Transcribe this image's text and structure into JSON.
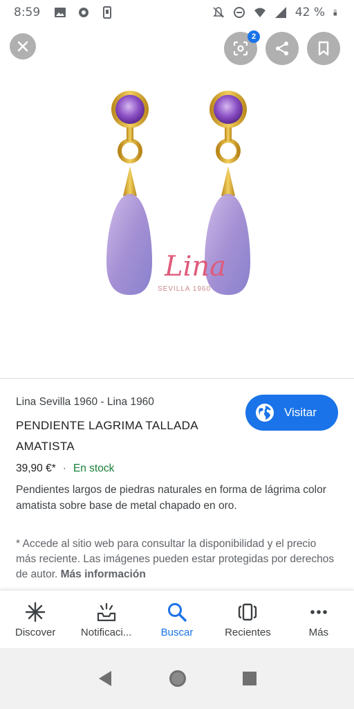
{
  "status_bar": {
    "time": "8:59",
    "battery_percent": "42 %"
  },
  "viewer": {
    "lens_badge_count": "2",
    "watermark_brand": "Lina",
    "watermark_sub": "SEVILLA 1960"
  },
  "product": {
    "source": "Lina Sevilla 1960 - Lina 1960",
    "title": "PENDIENTE LAGRIMA TALLADA AMATISTA",
    "visit_label": "Visitar",
    "price": "39,90 €*",
    "separator": "·",
    "stock": "En stock",
    "description": "Pendientes largos de piedras naturales en forma de lágrima color amatista sobre base de metal chapado en oro.",
    "disclaimer": "* Accede al sitio web para consultar la disponibilidad y el precio más reciente. Las imágenes pueden estar protegidas por derechos de autor.",
    "more_info": "Más información"
  },
  "bottom_nav": {
    "items": [
      {
        "label": "Discover",
        "icon": "discover-icon"
      },
      {
        "label": "Notificaci...",
        "icon": "notifications-icon"
      },
      {
        "label": "Buscar",
        "icon": "search-icon"
      },
      {
        "label": "Recientes",
        "icon": "recents-icon"
      },
      {
        "label": "Más",
        "icon": "more-icon"
      }
    ],
    "active_index": 2
  },
  "colors": {
    "accent": "#1a73e8",
    "stock_green": "#188038",
    "button_gray": "#b0b0b0",
    "amethyst": "#9b7fc9",
    "gold": "#d9a52a"
  }
}
